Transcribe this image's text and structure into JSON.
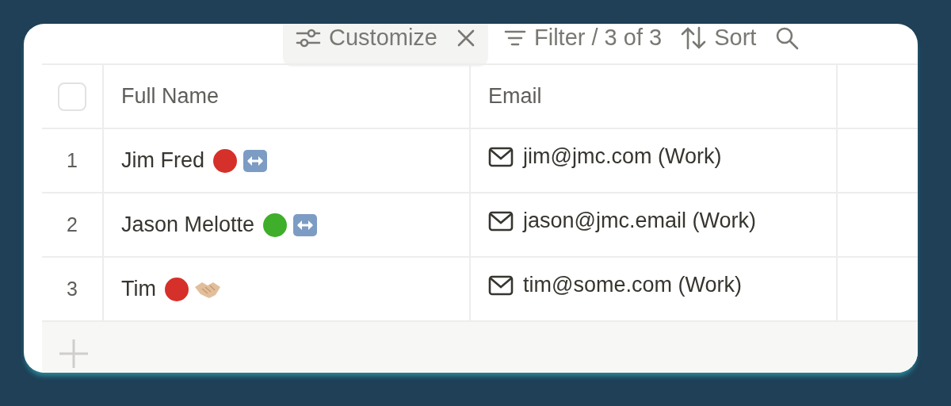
{
  "toolbar": {
    "customize": "Customize",
    "filter": "Filter / 3 of 3",
    "sort": "Sort"
  },
  "table": {
    "select_all": {
      "checked": false
    },
    "columns": [
      "Full Name",
      "Email"
    ],
    "rows": [
      {
        "number": "1",
        "name": "Jim Fred",
        "color": "#d6302a",
        "tag": {
          "kind": "arrows"
        },
        "email": "jim@jmc.com (Work)"
      },
      {
        "number": "2",
        "name": "Jason Melotte",
        "color": "#3fae2a",
        "tag": {
          "kind": "arrows"
        },
        "email": "jason@jmc.email (Work)"
      },
      {
        "number": "3",
        "name": "Tim",
        "color": "#d6302a",
        "tag": {
          "kind": "handshake"
        },
        "email": "tim@some.com (Work)"
      }
    ]
  }
}
